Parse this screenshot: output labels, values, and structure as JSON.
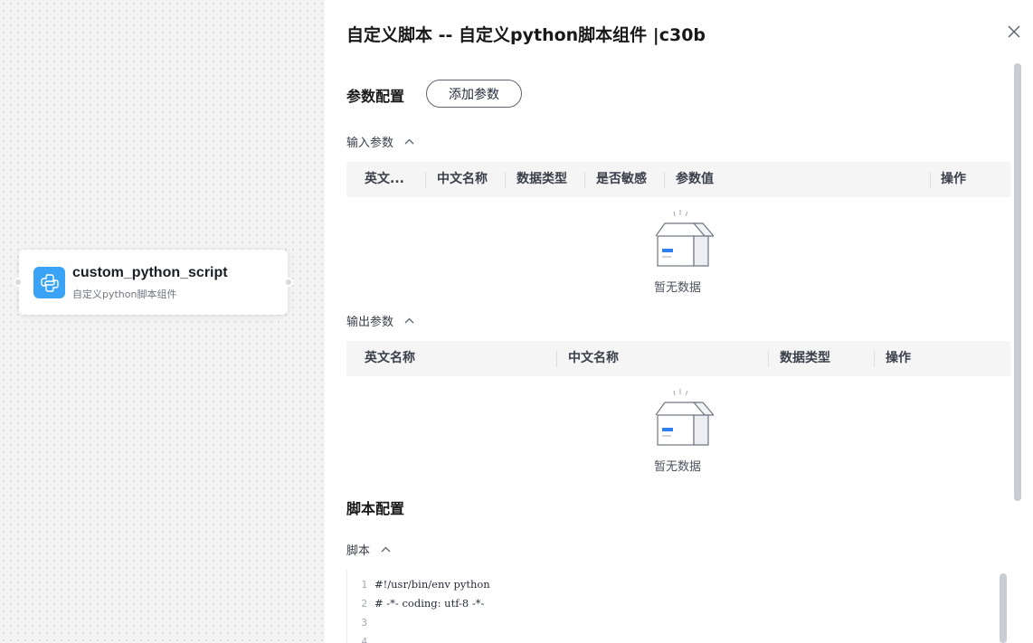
{
  "node": {
    "title": "custom_python_script",
    "subtitle": "自定义python脚本组件",
    "icon": "python-icon",
    "icon_color": "#3aa3f5"
  },
  "drawer": {
    "title": "自定义脚本 -- 自定义python脚本组件 |c30b",
    "close_icon": "close-icon"
  },
  "params": {
    "section_title": "参数配置",
    "add_button": "添加参数",
    "inputs": {
      "label": "输入参数",
      "columns": [
        "英文...",
        "中文名称",
        "数据类型",
        "是否敏感",
        "参数值",
        "操作"
      ],
      "empty_text": "暂无数据"
    },
    "outputs": {
      "label": "输出参数",
      "columns": [
        "英文名称",
        "中文名称",
        "数据类型",
        "操作"
      ],
      "empty_text": "暂无数据"
    }
  },
  "script": {
    "section_title": "脚本配置",
    "label": "脚本",
    "lines": [
      {
        "num": "1",
        "text": "#!/usr/bin/env python"
      },
      {
        "num": "2",
        "text": "# -*- coding: utf-8 -*-"
      },
      {
        "num": "3",
        "text": ""
      },
      {
        "num": "4",
        "text": ""
      }
    ]
  },
  "colors": {
    "accent": "#3aa3f5",
    "header_bg": "#f5f5f6",
    "canvas_bg": "#f3f3f4"
  }
}
